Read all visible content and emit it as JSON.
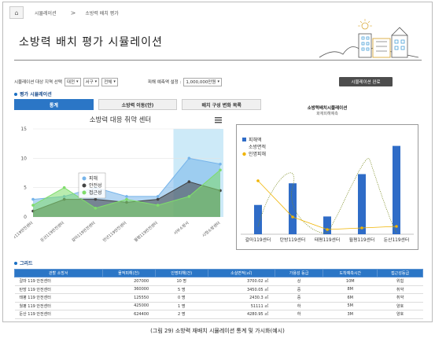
{
  "breadcrumb": {
    "home_icon": "home-icon",
    "item1": "시뮬레이션",
    "separator": ">",
    "item2": "소방력 배치 평가"
  },
  "page": {
    "title": "소방력 배치 평가 시뮬레이션"
  },
  "filters": {
    "region_label": "시뮬레이션 대상 지역 선택",
    "region_values": [
      "대전",
      "서구",
      "전체"
    ],
    "budget_label": "피해 예측액 설정 :",
    "budget_value": "1,000,000만원",
    "run_button": "시뮬레이션 완료"
  },
  "section_eval": "평가 시뮬레이션",
  "tabs": [
    "통계",
    "소방력 이동(안)",
    "배치 구성 변화 목록"
  ],
  "chart1": {
    "title": "소방력 대응 취약 센터",
    "menu_icon": "hamburger-menu-icon",
    "legend": [
      "피해",
      "안전성",
      "접근성"
    ],
    "colors": [
      "#76b4ea",
      "#444444",
      "#7fdc6b"
    ],
    "highlight": "#cdeaf8"
  },
  "chart2": {
    "title": "소방력배치시뮬레이션",
    "subtitle": "화재피해예측",
    "legend": [
      "피해액",
      "소방면적",
      "인명피해"
    ],
    "bar_color": "#2f6cc7",
    "line_color": "#f0b400"
  },
  "chart_data": [
    {
      "type": "area",
      "title": "소방력 대응 취약 센터",
      "categories": [
        "대화119안전센터",
        "둔산119안전센터",
        "갈마119안전센터",
        "만년119안전센터",
        "월평119안전센터",
        "서부소방서",
        "시청소방센터"
      ],
      "ylim": [
        0,
        15
      ],
      "yticks": [
        0,
        5,
        10,
        15
      ],
      "series": [
        {
          "name": "피해",
          "values": [
            3,
            3.5,
            5,
            3.5,
            3.5,
            10,
            9
          ]
        },
        {
          "name": "안전성",
          "values": [
            1,
            3,
            3,
            2.5,
            3,
            6,
            4.5
          ]
        },
        {
          "name": "접근성",
          "values": [
            2,
            5,
            1.5,
            3,
            2,
            3.5,
            8
          ]
        }
      ]
    },
    {
      "type": "bar",
      "title": "소방력배치시뮬레이션",
      "categories": [
        "갈마119센터",
        "탄방119센터",
        "태평119센터",
        "월평119센터",
        "둔산119센터"
      ],
      "series": [
        {
          "name": "피해액",
          "values": [
            207000,
            360000,
            125550,
            425000,
            624400
          ]
        },
        {
          "name": "인명피해",
          "values": [
            10,
            5,
            0,
            1,
            2
          ]
        }
      ]
    }
  ],
  "section_grid": "그리드",
  "table": {
    "headers": [
      "관할 소방서",
      "물적피해(천)",
      "인명피해(건)",
      "소실면적(㎡)",
      "가용성 등급",
      "도착예측시간",
      "접근성등급"
    ],
    "rows": [
      [
        "갈마 119 안전센터",
        "207000",
        "10 명",
        "3700.02 ㎡",
        "상",
        "10M",
        "위험"
      ],
      [
        "탄방 119 안전센터",
        "360000",
        "5 명",
        "3450.05 ㎡",
        "중",
        "8M",
        "취약"
      ],
      [
        "태평 119 안전센터",
        "125550",
        "0 명",
        "2430.3 ㎡",
        "중",
        "6M",
        "취약"
      ],
      [
        "월평 119 안전센터",
        "425000",
        "1 명",
        "51111 ㎡",
        "하",
        "5M",
        "양호"
      ],
      [
        "둔산 119 안전센터",
        "624400",
        "2 명",
        "4280.95 ㎡",
        "하",
        "3M",
        "양호"
      ]
    ]
  },
  "caption": "(그림 29) 소방력 재배치 시뮬레이션 통계 및 가시화(예시)"
}
